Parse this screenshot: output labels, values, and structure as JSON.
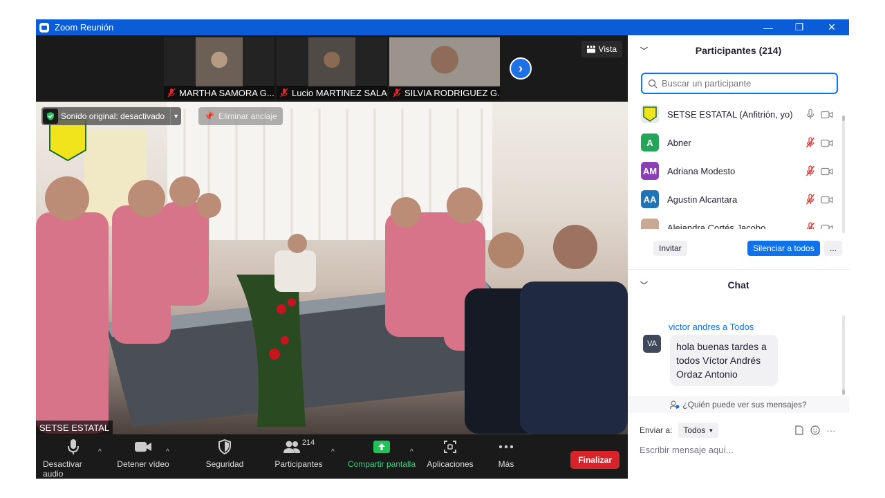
{
  "window": {
    "title": "Zoom Reunión",
    "min": "—",
    "restore": "❐",
    "close": "✕"
  },
  "thumbnails": [
    {
      "name": "MARTHA SAMORA G...",
      "bg": "#6b5f56",
      "face": "#b59b82"
    },
    {
      "name": "Lucio MARTINEZ SALAS",
      "bg": "#4f4a45",
      "face": "#8a6a52"
    },
    {
      "name": "SILVIA RODRIGUEZ G...",
      "bg": "#9a948d",
      "face": "#8f6c5a"
    }
  ],
  "view_button": "Vista",
  "sound_original": "Sonido original: desactivado",
  "unpin": "Eliminar anclaje",
  "active_speaker": "SETSE ESTATAL",
  "toolbar": {
    "mute": "Desactivar audio",
    "video": "Detener vídeo",
    "security": "Seguridad",
    "participants": "Participantes",
    "participants_count": "214",
    "share": "Compartir pantalla",
    "apps": "Aplicaciones",
    "more": "Más",
    "end": "Finalizar"
  },
  "participants_panel": {
    "title": "Participantes (214)",
    "search_placeholder": "Buscar un participante",
    "list": [
      {
        "initials": "",
        "name": "SETSE ESTATAL (Anfitrión, yo)",
        "color": "#e8e8e8",
        "muted": false
      },
      {
        "initials": "A",
        "name": "Abner",
        "color": "#23a55a",
        "muted": true
      },
      {
        "initials": "AM",
        "name": "Adriana Modesto",
        "color": "#8a3fb4",
        "muted": true
      },
      {
        "initials": "AA",
        "name": "Agustin Alcantara",
        "color": "#1f73b7",
        "muted": true
      },
      {
        "initials": "",
        "name": "Alejandra Cortés Jacobo",
        "color": "#c9a894",
        "muted": true
      }
    ],
    "invite": "Invitar",
    "mute_all": "Silenciar a todos",
    "more": "..."
  },
  "chat": {
    "title": "Chat",
    "from": "victor andres a Todos",
    "avatar": "VA",
    "message": "hola buenas tardes a todos Víctor Andrés Ordaz Antonio",
    "who_sees": "¿Quién puede ver sus mensajes?",
    "send_to_label": "Enviar a:",
    "send_to_value": "Todos",
    "input_placeholder": "Escribir mensaje aquí..."
  }
}
